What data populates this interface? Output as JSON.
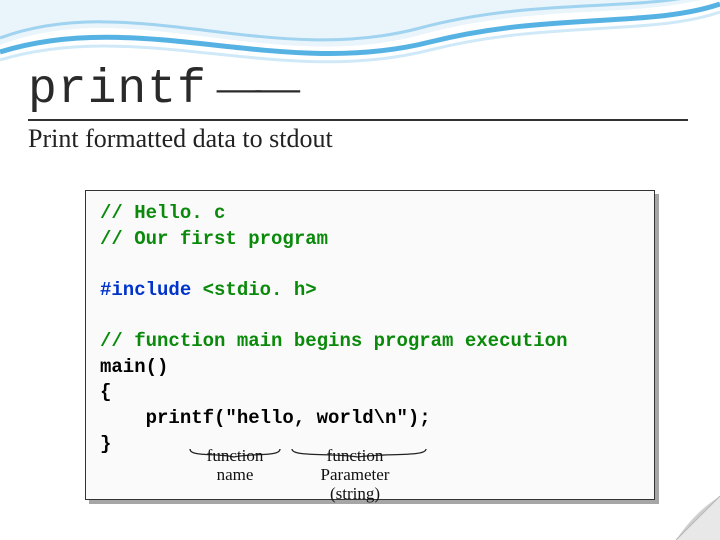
{
  "title": {
    "function_name": "printf",
    "dash": "——",
    "subtitle": "Print formatted data to stdout"
  },
  "code": {
    "comment1": "// Hello. c",
    "comment2": "// Our first program",
    "include_directive": "#include",
    "include_header": " <stdio. h>",
    "comment3": "// function main begins program execution",
    "main_line": "main()",
    "brace_open": "{",
    "printf_line": "    printf(\"hello, world\\n\");",
    "brace_close": "}"
  },
  "annotations": {
    "func_name": "function\nname",
    "func_param": "function\nParameter\n(string)"
  }
}
